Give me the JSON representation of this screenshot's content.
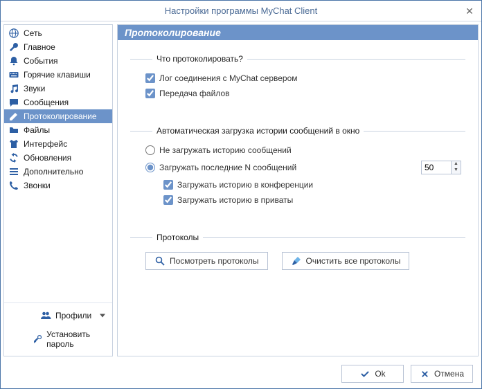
{
  "window": {
    "title": "Настройки программы MyChat Client"
  },
  "sidebar": {
    "items": [
      {
        "label": "Сеть"
      },
      {
        "label": "Главное"
      },
      {
        "label": "События"
      },
      {
        "label": "Горячие клавиши"
      },
      {
        "label": "Звуки"
      },
      {
        "label": "Сообщения"
      },
      {
        "label": "Протоколирование"
      },
      {
        "label": "Файлы"
      },
      {
        "label": "Интерфейс"
      },
      {
        "label": "Обновления"
      },
      {
        "label": "Дополнительно"
      },
      {
        "label": "Звонки"
      }
    ],
    "profiles_label": "Профили",
    "set_password_label": "Установить пароль"
  },
  "content": {
    "header": "Протоколирование",
    "group_what": {
      "legend": "Что протоколировать?",
      "chk_conn": "Лог соединения с MyChat сервером",
      "chk_files": "Передача файлов"
    },
    "group_history": {
      "legend": "Автоматическая загрузка истории сообщений в окно",
      "radio_none": "Не загружать историю сообщений",
      "radio_last_n": "Загружать последние N сообщений",
      "n_value": "50",
      "chk_conf": "Загружать историю в конференции",
      "chk_priv": "Загружать историю в приваты"
    },
    "group_protocols": {
      "legend": "Протоколы",
      "btn_view": "Посмотреть протоколы",
      "btn_clear": "Очистить все протоколы"
    }
  },
  "footer": {
    "ok": "Ok",
    "cancel": "Отмена"
  }
}
